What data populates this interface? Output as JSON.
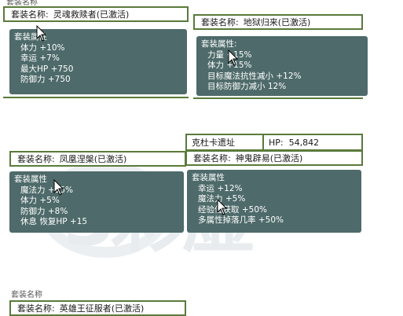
{
  "watermark": {
    "text": "3彩虚"
  },
  "top_fragment": {
    "text": "套装名称"
  },
  "bottom_fragment": {
    "text": "套装名称"
  },
  "sets": [
    {
      "name_label": "套装名称:",
      "name_value": "灵魂救赎者(已激活)",
      "attr_header": "套装属性",
      "attrs": [
        "体力 +10%",
        "幸运 +7%",
        "最大HP +750",
        "防御力 +750"
      ]
    },
    {
      "name_label": "套装名称:",
      "name_value": "地狱归来(已激活)",
      "attr_header": "套装属性:",
      "attrs": [
        "力量 +15%",
        "体力 +15%",
        "目标魔法抗性减小 +12%",
        "目标防御力减小 12%"
      ]
    },
    {
      "name_label": "套装名称:",
      "name_value": "凤凰涅槃(已激活)",
      "attr_header": "套装属性",
      "attrs": [
        "魔法力 +15%",
        "体力 +5%",
        "防御力 +8%",
        "休息 恢复HP +15"
      ]
    },
    {
      "location": "克杜卡遗址",
      "hp_label": "HP:",
      "hp_value": "54,842",
      "name_label": "套装名称:",
      "name_value": "神鬼辟易(已激活)",
      "attr_header": "套装属性",
      "attrs": [
        "幸运 +12%",
        "魔法力 +5%",
        "经验值获取 +50%",
        "多属性掉落几率 +50%"
      ]
    },
    {
      "name_label": "套装名称:",
      "name_value": "英雄王征服者(已激活)"
    }
  ],
  "colors": {
    "panel": "#4e6a6a",
    "border": "#5a7a3a"
  }
}
